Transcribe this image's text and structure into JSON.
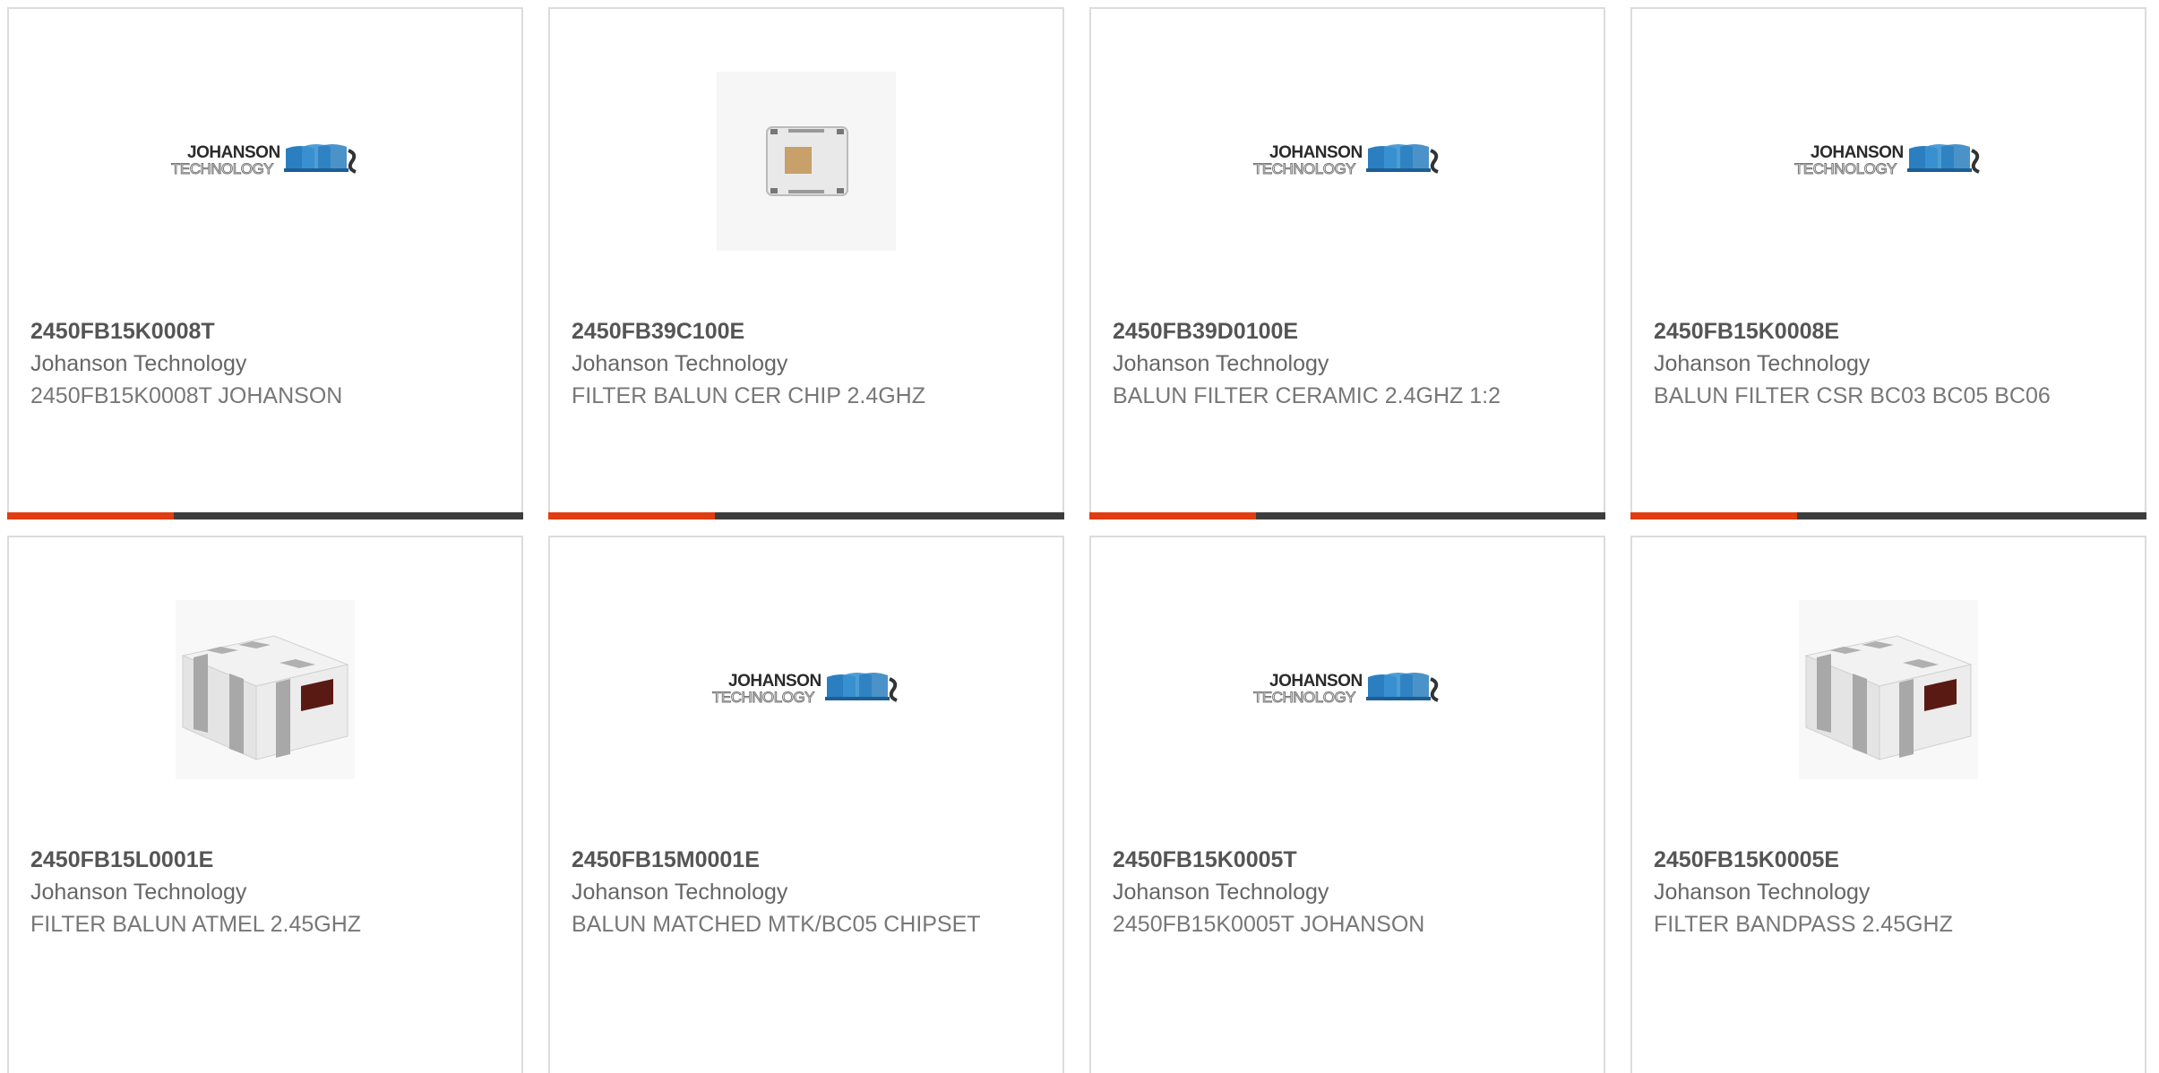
{
  "products": [
    {
      "part_number": "2450FB15K0008T",
      "manufacturer": "Johanson Technology",
      "description": "2450FB15K0008T JOHANSON",
      "image": "johanson-logo"
    },
    {
      "part_number": "2450FB39C100E",
      "manufacturer": "Johanson Technology",
      "description": "FILTER BALUN CER CHIP 2.4GHZ",
      "image": "chip-photo"
    },
    {
      "part_number": "2450FB39D0100E",
      "manufacturer": "Johanson Technology",
      "description": "BALUN FILTER CERAMIC 2.4GHZ 1:2",
      "image": "johanson-logo"
    },
    {
      "part_number": "2450FB15K0008E",
      "manufacturer": "Johanson Technology",
      "description": "BALUN FILTER CSR BC03 BC05 BC06",
      "image": "johanson-logo"
    },
    {
      "part_number": "2450FB15L0001E",
      "manufacturer": "Johanson Technology",
      "description": "FILTER BALUN ATMEL 2.45GHZ",
      "image": "balun-photo"
    },
    {
      "part_number": "2450FB15M0001E",
      "manufacturer": "Johanson Technology",
      "description": "BALUN MATCHED MTK/BC05 CHIPSET",
      "image": "johanson-logo"
    },
    {
      "part_number": "2450FB15K0005T",
      "manufacturer": "Johanson Technology",
      "description": "2450FB15K0005T JOHANSON",
      "image": "johanson-logo"
    },
    {
      "part_number": "2450FB15K0005E",
      "manufacturer": "Johanson Technology",
      "description": "FILTER BANDPASS 2.45GHZ",
      "image": "balun-photo"
    }
  ],
  "logo": {
    "line1": "JOHANSON",
    "line2": "TECHNOLOGY"
  },
  "colors": {
    "accent": "#e03d12",
    "bar": "#3d3d3d",
    "border": "#dcdcdc"
  }
}
